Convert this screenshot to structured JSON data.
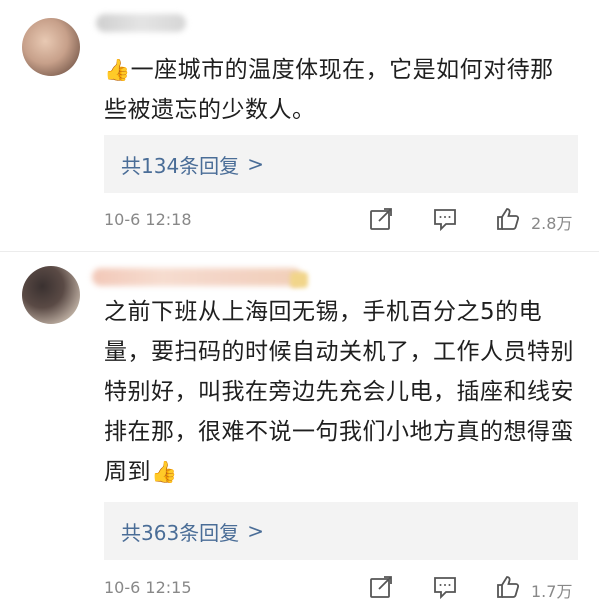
{
  "comments": [
    {
      "text": "一座城市的温度体现在，它是如何对待那些被遗忘的少数人。",
      "replies_label": "共134条回复",
      "time": "10-6 12:18",
      "likes": "2.8万"
    },
    {
      "text": "之前下班从上海回无锡，手机百分之5的电量，要扫码的时候自动关机了，工作人员特别特别好，叫我在旁边先充会儿电，插座和线安排在那，很难不说一句我们小地方真的想得蛮周到",
      "replies_label": "共363条回复",
      "time": "10-6 12:15",
      "likes": "1.7万"
    }
  ],
  "icons": {
    "thumb": "thumbs-up-emoji",
    "share": "share-icon",
    "reply": "comment-icon",
    "like": "like-icon",
    "chevron": "chevron-right-icon"
  },
  "colors": {
    "link": "#4a6d97",
    "meta": "#888888",
    "reply_bg": "#f3f3f3"
  }
}
